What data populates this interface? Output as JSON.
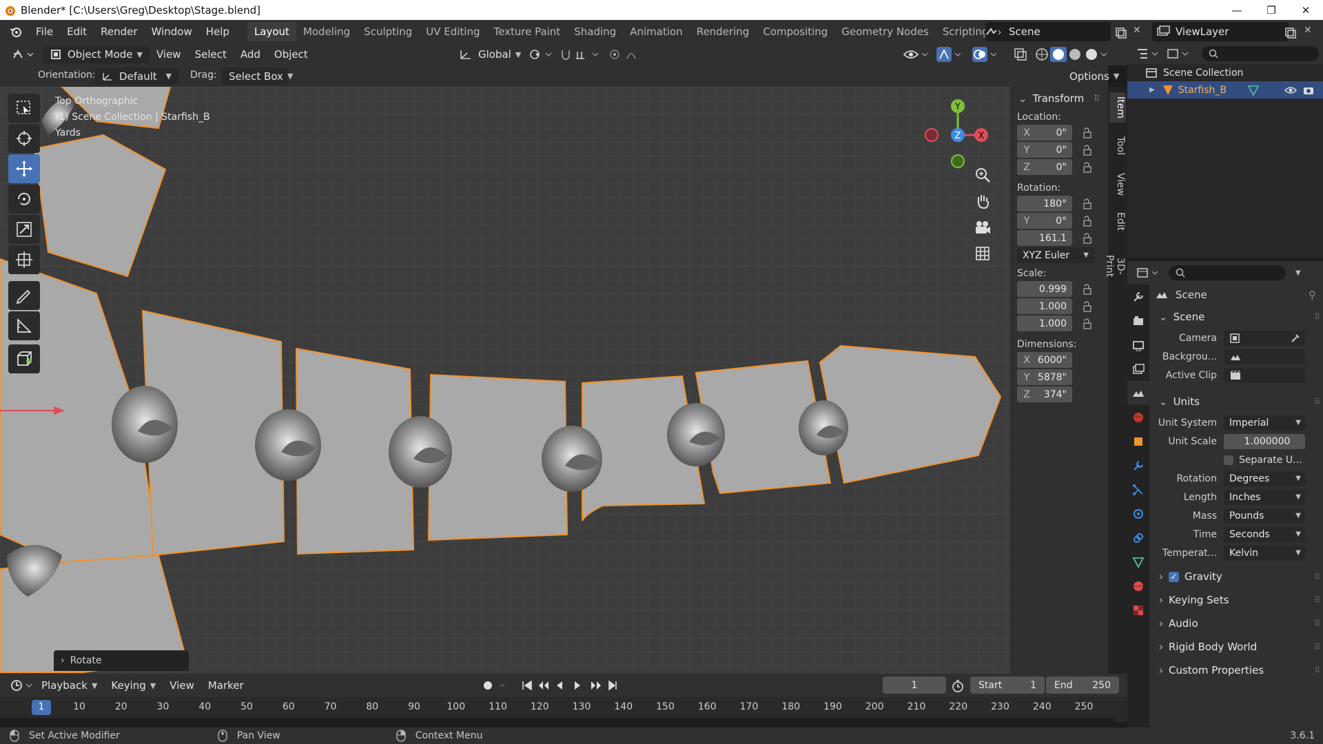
{
  "window": {
    "title": "Blender* [C:\\Users\\Greg\\Desktop\\Stage.blend]",
    "minimize": "—",
    "maximize": "❐",
    "close": "✕"
  },
  "menus": [
    "File",
    "Edit",
    "Render",
    "Window",
    "Help"
  ],
  "workspaces": [
    "Layout",
    "Modeling",
    "Sculpting",
    "UV Editing",
    "Texture Paint",
    "Shading",
    "Animation",
    "Rendering",
    "Compositing",
    "Geometry Nodes",
    "Scripting"
  ],
  "active_workspace": "Layout",
  "scene_name": "Scene",
  "view_layer": "ViewLayer",
  "header": {
    "mode": "Object Mode",
    "menus": [
      "View",
      "Select",
      "Add",
      "Object"
    ],
    "transform_orientation": "Global",
    "options_label": "Options"
  },
  "subheader": {
    "orientation_label": "Orientation:",
    "orientation_value": "Default",
    "drag_label": "Drag:",
    "drag_value": "Select Box"
  },
  "viewport": {
    "view_name": "Top Orthographic",
    "collection": "(1) Scene Collection | Starfish_B",
    "units": "Yards",
    "last_op": "Rotate",
    "axes": {
      "x": "X",
      "y": "Y",
      "z": "Z"
    }
  },
  "transform": {
    "title": "Transform",
    "location_label": "Location:",
    "location": [
      {
        "axis": "X",
        "value": "0\""
      },
      {
        "axis": "Y",
        "value": "0\""
      },
      {
        "axis": "Z",
        "value": "0\""
      }
    ],
    "rotation_label": "Rotation:",
    "rotation": [
      {
        "axis": "",
        "value": "180°"
      },
      {
        "axis": "Y",
        "value": "0°"
      },
      {
        "axis": "",
        "value": "161.1"
      }
    ],
    "rotation_mode": "XYZ Euler",
    "scale_label": "Scale:",
    "scale": [
      "0.999",
      "1.000",
      "1.000"
    ],
    "dimensions_label": "Dimensions:",
    "dimensions": [
      {
        "axis": "X",
        "value": "6000\""
      },
      {
        "axis": "Y",
        "value": "5878\""
      },
      {
        "axis": "Z",
        "value": "374\""
      }
    ]
  },
  "n_tabs": [
    "Item",
    "Tool",
    "View",
    "Edit",
    "3D-Print"
  ],
  "outliner": {
    "root": "Scene Collection",
    "object": "Starfish_B"
  },
  "properties": {
    "context": "Scene",
    "scene_section": "Scene",
    "camera_label": "Camera",
    "background_label": "Backgrou...",
    "active_clip_label": "Active Clip",
    "units_section": "Units",
    "unit_system_label": "Unit System",
    "unit_system": "Imperial",
    "unit_scale_label": "Unit Scale",
    "unit_scale": "1.000000",
    "separate_units": "Separate U...",
    "rotation_label": "Rotation",
    "rotation": "Degrees",
    "length_label": "Length",
    "length": "Inches",
    "mass_label": "Mass",
    "mass": "Pounds",
    "time_label": "Time",
    "time": "Seconds",
    "temperature_label": "Temperat...",
    "temperature": "Kelvin",
    "collapsed_sections": [
      "Gravity",
      "Keying Sets",
      "Audio",
      "Rigid Body World",
      "Custom Properties"
    ]
  },
  "timeline": {
    "menus": [
      "Playback",
      "Keying",
      "View",
      "Marker"
    ],
    "current_frame": "1",
    "start_label": "Start",
    "start": "1",
    "end_label": "End",
    "end": "250",
    "ruler": [
      "1",
      "10",
      "20",
      "30",
      "40",
      "50",
      "60",
      "70",
      "80",
      "90",
      "100",
      "110",
      "120",
      "130",
      "140",
      "150",
      "160",
      "170",
      "180",
      "190",
      "200",
      "210",
      "220",
      "230",
      "240",
      "250"
    ]
  },
  "status": {
    "left": "Set Active Modifier",
    "middle": "Pan View",
    "right": "Context Menu",
    "version": "3.6.1"
  },
  "colors": {
    "selection_outline": "#f0922e",
    "active_tool": "#4772b3",
    "x_axis": "#e24c58",
    "y_axis": "#7fbf3b",
    "z_axis": "#3b8de8"
  }
}
